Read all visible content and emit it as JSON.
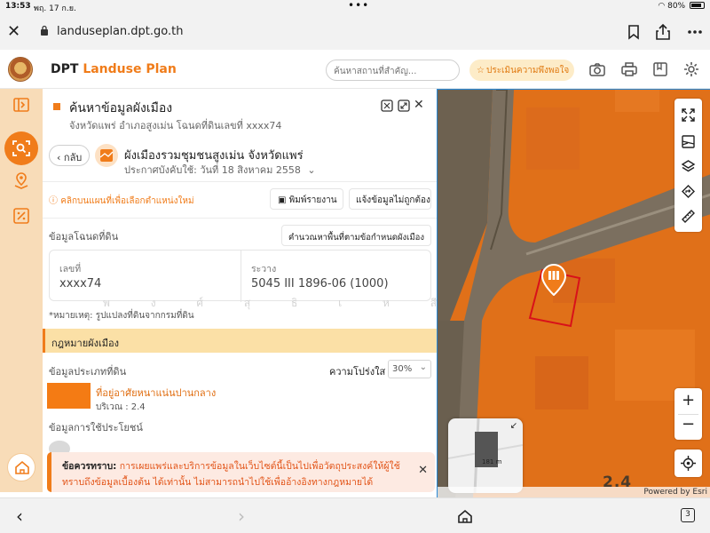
{
  "status_bar": {
    "time": "13:53",
    "date": "พฤ. 17 ก.ย.",
    "battery": "80%"
  },
  "browser": {
    "url": "landuseplan.dpt.go.th"
  },
  "header": {
    "brand_dpt": "DPT",
    "brand_name": "Landuse Plan",
    "search_placeholder": "ค้นหาสถานที่สำคัญ...",
    "rate_label": "ประเมินความพึงพอใจ"
  },
  "panel": {
    "title": "ค้นหาข้อมูลผังเมือง",
    "subtitle": "จังหวัดแพร่ อำเภอสูงเม่น โฉนดที่ดินเลขที่ xxxx74",
    "back_label": "กลับ",
    "plan_title": "ผังเมืองรวมชุมชนสูงเม่น จังหวัดแพร่",
    "plan_date": "ประกาศบังคับใช้: วันที่ 18 สิงหาคม 2558",
    "hint": "คลิกบนแผนที่เพื่อเลือกตำแหน่งใหม่",
    "print_label": "พิมพ์รายงาน",
    "report_label": "แจ้งข้อมูลไม่ถูกต้อง",
    "deed_section": "ข้อมูลโฉนดที่ดิน",
    "calc_label": "คำนวณหาพื้นที่ตามข้อกำหนดผังเมือง",
    "deed": {
      "no_label": "เลขที่",
      "no_value": "xxxx74",
      "sheet_label": "ระวาง",
      "sheet_value": "5045 III 1896-06 (1000)"
    },
    "watermark": "พ ง ศ์ สุ ธิ เ ห สี อ ร เ ล สี",
    "note": "*หมายเหตุ: รูปแปลงที่ดินจากกรมที่ดิน",
    "law_section": "กฎหมายผังเมือง",
    "zone_section": "ข้อมูลประเภทที่ดิน",
    "opacity_label": "ความโปร่งใส",
    "opacity_value": "30%",
    "zone_name": "ที่อยู่อาศัยหนาแน่นปานกลาง",
    "zone_area": "บริเวณ : 2.4",
    "usage_section": "ข้อมูลการใช้ประโยชน์",
    "zone_color": "#f47b14"
  },
  "disclaimer": {
    "lead": "ข้อควรทราบ:",
    "line1": " การเผยแพร่และบริการข้อมูลในเว็บไซต์นี้เป็นไปเพื่อวัตถุประสงค์ให้ผู้ใช้",
    "line2": "ทราบถึงข้อมูลเบื้องต้น ได้เท่านั้น ไม่สามารถนำไปใช้เพื่ออ้างอิงทางกฎหมายได้"
  },
  "map": {
    "overview_scale": "181 m",
    "zone_label": "2.4",
    "attribution": "Powered by Esri"
  },
  "bottom_bar": {
    "tab_count": "3"
  },
  "colors": {
    "accent": "#f07c1a",
    "zone_orange": "#e07019",
    "rail_bg": "#f8dcb8"
  }
}
